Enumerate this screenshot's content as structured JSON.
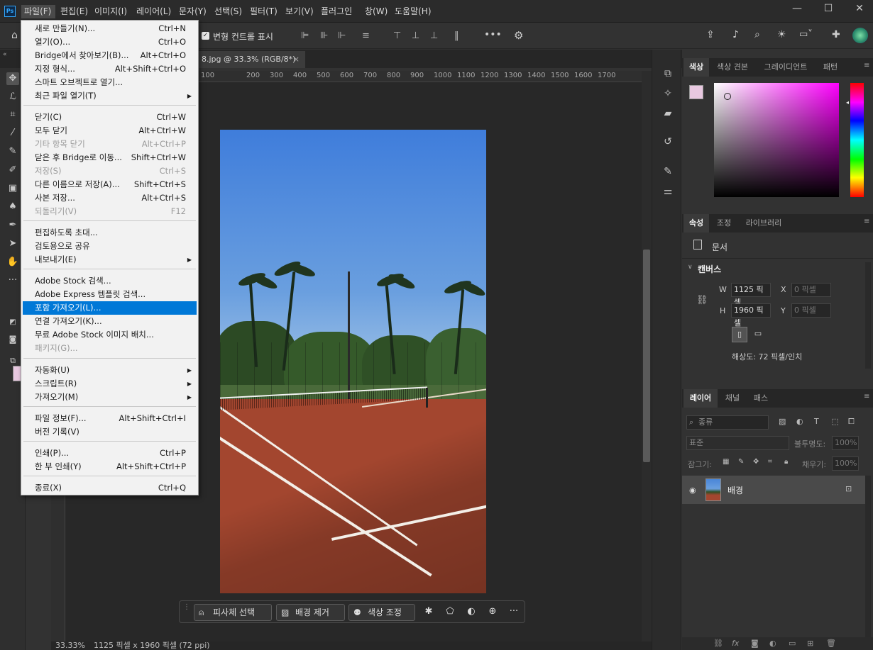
{
  "app": {
    "logo": "Ps"
  },
  "menubar": {
    "items": [
      "파일(F)",
      "편집(E)",
      "이미지(I)",
      "레이어(L)",
      "문자(Y)",
      "선택(S)",
      "필터(T)",
      "보기(V)",
      "플러그인",
      "창(W)",
      "도움말(H)"
    ]
  },
  "window": {
    "minimize": "—",
    "maximize": "☐",
    "close": "✕"
  },
  "options": {
    "transform_label": "변형 컨트롤 표시"
  },
  "document": {
    "tab": "8.jpg @ 33.3% (RGB/8*)",
    "tab_close": "×"
  },
  "ruler": {
    "top": [
      "100",
      "200",
      "300",
      "400",
      "500",
      "600",
      "700",
      "800",
      "900",
      "1000",
      "1100",
      "1200",
      "1300",
      "1400",
      "1500",
      "1600",
      "1700"
    ]
  },
  "file_menu": {
    "items": [
      {
        "label": "새로 만들기(N)...",
        "shortcut": "Ctrl+N"
      },
      {
        "label": "열기(O)...",
        "shortcut": "Ctrl+O"
      },
      {
        "label": "Bridge에서 찾아보기(B)...",
        "shortcut": "Alt+Ctrl+O"
      },
      {
        "label": "지정 형식...",
        "shortcut": "Alt+Shift+Ctrl+O"
      },
      {
        "label": "스마트 오브젝트로 열기...",
        "shortcut": ""
      },
      {
        "label": "최근 파일 열기(T)",
        "shortcut": ""
      },
      {
        "label": "닫기(C)",
        "shortcut": "Ctrl+W"
      },
      {
        "label": "모두 닫기",
        "shortcut": "Alt+Ctrl+W"
      },
      {
        "label": "기타 항목 닫기",
        "shortcut": "Alt+Ctrl+P"
      },
      {
        "label": "닫은 후 Bridge로 이동...",
        "shortcut": "Shift+Ctrl+W"
      },
      {
        "label": "저장(S)",
        "shortcut": "Ctrl+S"
      },
      {
        "label": "다른 이름으로 저장(A)...",
        "shortcut": "Shift+Ctrl+S"
      },
      {
        "label": "사본 저장...",
        "shortcut": "Alt+Ctrl+S"
      },
      {
        "label": "되돌리기(V)",
        "shortcut": "F12"
      },
      {
        "label": "편집하도록 초대...",
        "shortcut": ""
      },
      {
        "label": "검토용으로 공유",
        "shortcut": ""
      },
      {
        "label": "내보내기(E)",
        "shortcut": ""
      },
      {
        "label": "Adobe Stock 검색...",
        "shortcut": ""
      },
      {
        "label": "Adobe Express 템플릿 검색...",
        "shortcut": ""
      },
      {
        "label": "포함 가져오기(L)...",
        "shortcut": ""
      },
      {
        "label": "연결 가져오기(K)...",
        "shortcut": ""
      },
      {
        "label": "무료 Adobe Stock 이미지 배치...",
        "shortcut": ""
      },
      {
        "label": "패키지(G)...",
        "shortcut": ""
      },
      {
        "label": "자동화(U)",
        "shortcut": ""
      },
      {
        "label": "스크립트(R)",
        "shortcut": ""
      },
      {
        "label": "가져오기(M)",
        "shortcut": ""
      },
      {
        "label": "파일 정보(F)...",
        "shortcut": "Alt+Shift+Ctrl+I"
      },
      {
        "label": "버전 기록(V)",
        "shortcut": ""
      },
      {
        "label": "인쇄(P)...",
        "shortcut": "Ctrl+P"
      },
      {
        "label": "한 부 인쇄(Y)",
        "shortcut": "Alt+Shift+Ctrl+P"
      },
      {
        "label": "종료(X)",
        "shortcut": "Ctrl+Q"
      }
    ]
  },
  "context_bar": {
    "select_subject": "피사체 선택",
    "remove_bg": "배경 제거",
    "color_adjust": "색상 조정"
  },
  "color_panel": {
    "tabs": [
      "색상",
      "색상 견본",
      "그레이디언트",
      "패턴"
    ]
  },
  "properties_panel": {
    "tabs": [
      "속성",
      "조정",
      "라이브러리"
    ],
    "doc_label": "문서",
    "canvas_header": "캔버스",
    "w_label": "W",
    "w_value": "1125 픽셀",
    "h_label": "H",
    "h_value": "1960 픽셀",
    "x_label": "X",
    "x_value": "0 픽셀",
    "y_label": "Y",
    "y_value": "0 픽셀",
    "resolution": "해상도: 72 픽셀/인치"
  },
  "layers_panel": {
    "tabs": [
      "레이어",
      "채널",
      "패스"
    ],
    "search_placeholder": "종류",
    "blend_mode": "표준",
    "opacity_label": "불투명도:",
    "opacity_value": "100%",
    "lock_label": "잠그기:",
    "fill_label": "채우기:",
    "fill_value": "100%",
    "layer_name": "배경"
  },
  "status": {
    "zoom": "33.33%",
    "doc_size": "1125 픽셀 x 1960 픽셀 (72 ppi)"
  },
  "colors": {
    "accent": "#0078d7",
    "foreground": "#e8c8e0",
    "background": "#ffffff"
  }
}
